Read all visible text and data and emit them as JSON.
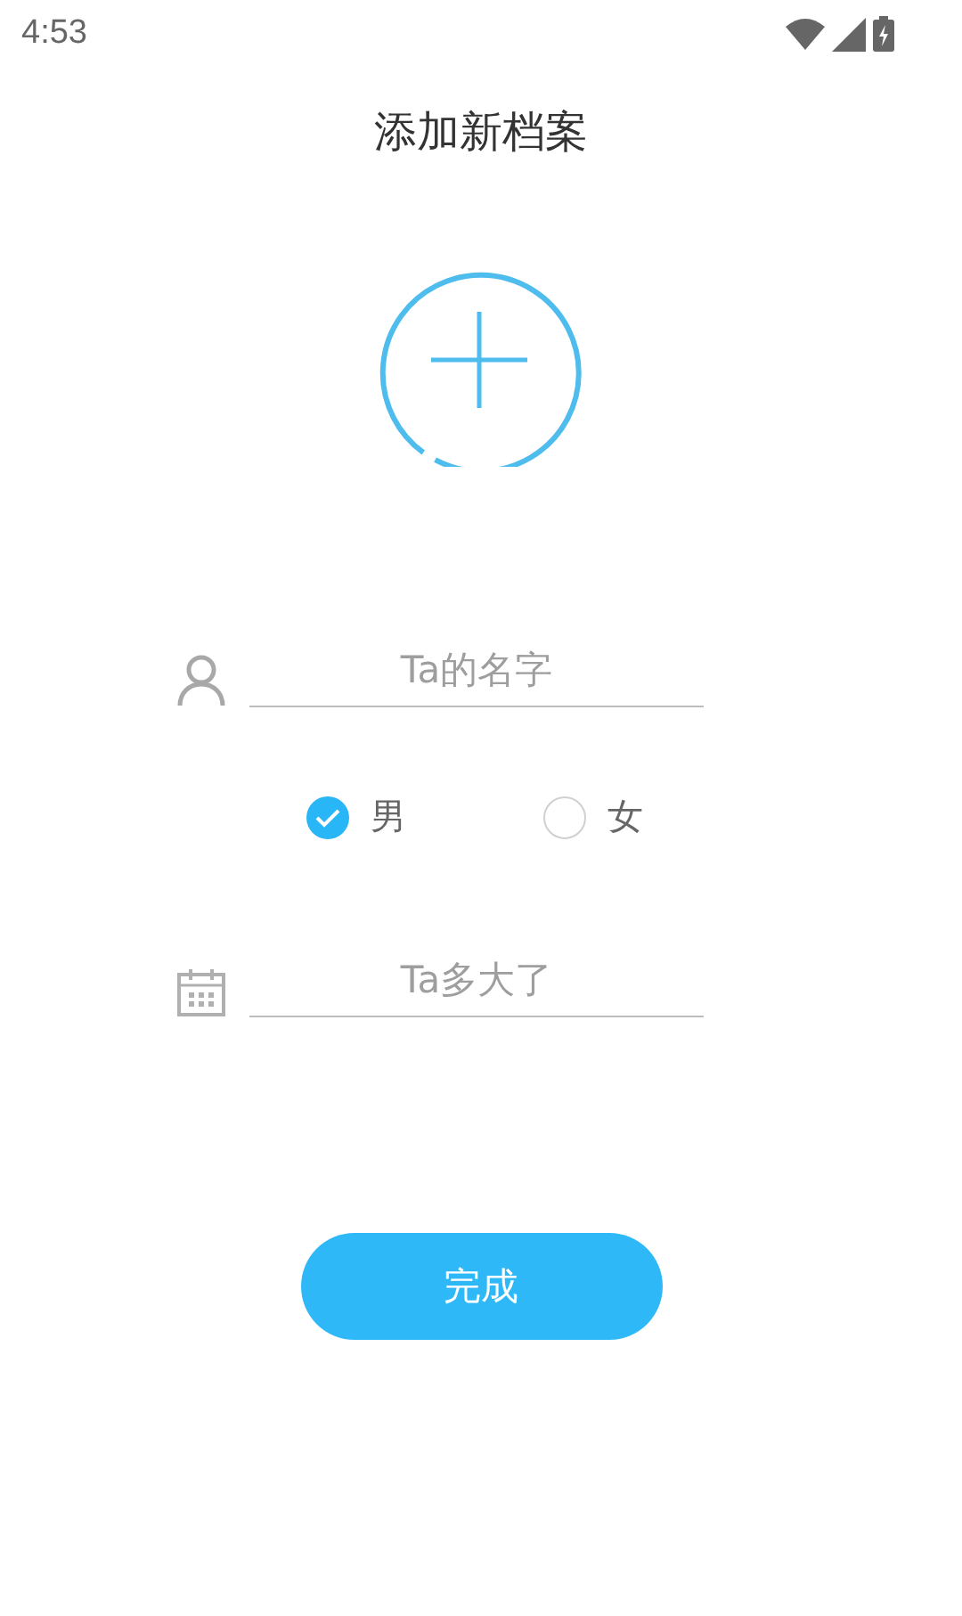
{
  "status_bar": {
    "time": "4:53"
  },
  "title": "添加新档案",
  "fields": [
    {
      "kind": "person",
      "placeholder": "Ta的名字"
    },
    {
      "kind": "calendar",
      "placeholder": "Ta多大了"
    }
  ],
  "gender": [
    {
      "label": "男",
      "selected": true
    },
    {
      "label": "女",
      "selected": false
    }
  ],
  "submit": "完成"
}
